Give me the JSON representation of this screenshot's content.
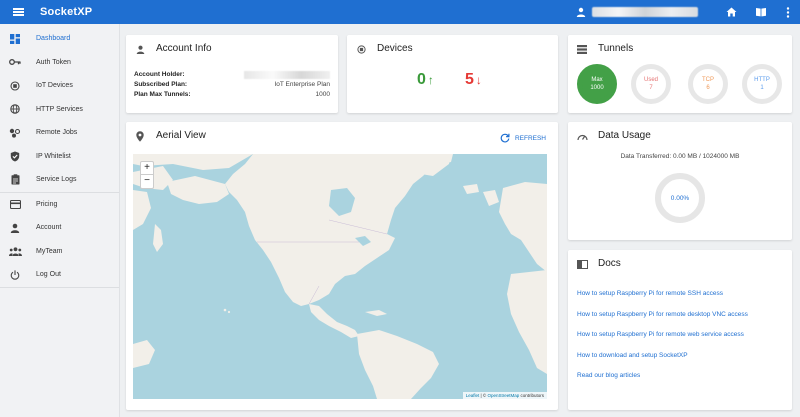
{
  "app": {
    "brand": "SocketXP"
  },
  "topbar": {
    "menu_icon": "hamburger-menu-icon",
    "user_icon": "person-icon",
    "home_icon": "home-icon",
    "docs_icon": "book-icon",
    "more_icon": "more-vertical-icon"
  },
  "sidebar": {
    "items": [
      {
        "label": "Dashboard",
        "icon": "dashboard-icon"
      },
      {
        "label": "Auth Token",
        "icon": "key-icon"
      },
      {
        "label": "IoT Devices",
        "icon": "device-icon"
      },
      {
        "label": "HTTP Services",
        "icon": "globe-icon"
      },
      {
        "label": "Remote Jobs",
        "icon": "jobs-icon"
      },
      {
        "label": "IP Whitelist",
        "icon": "shield-check-icon"
      },
      {
        "label": "Service Logs",
        "icon": "clipboard-icon"
      },
      {
        "label": "Pricing",
        "icon": "credit-card-icon"
      },
      {
        "label": "Account",
        "icon": "person-icon"
      },
      {
        "label": "MyTeam",
        "icon": "group-icon"
      },
      {
        "label": "Log Out",
        "icon": "power-icon"
      }
    ]
  },
  "account": {
    "title": "Account Info",
    "holder_label": "Account Holder:",
    "plan_label": "Subscribed Plan:",
    "plan_value": "IoT Enterprise Plan",
    "tunnels_label": "Plan Max Tunnels:",
    "tunnels_value": "1000"
  },
  "devices": {
    "title": "Devices",
    "online": "0",
    "offline": "5",
    "online_color": "#3a9a3a",
    "offline_color": "#e53935"
  },
  "tunnels": {
    "title": "Tunnels",
    "items": [
      {
        "label": "Max",
        "value": "1000",
        "color": "#43a047"
      },
      {
        "label": "Used",
        "value": "7",
        "color": "#e57373"
      },
      {
        "label": "TCP",
        "value": "6",
        "color": "#ef9a5a"
      },
      {
        "label": "HTTP",
        "value": "1",
        "color": "#5c9ded"
      }
    ]
  },
  "aerial": {
    "title": "Aerial View",
    "refresh_label": "REFRESH",
    "zoom_in": "+",
    "zoom_out": "−",
    "attribution_leaflet": "Leaflet",
    "attribution_sep": " | © ",
    "attribution_osm": "OpenStreetMap",
    "attribution_suffix": " contributors"
  },
  "data_usage": {
    "title": "Data Usage",
    "transferred": "Data Transferred: 0.00 MB / 1024000 MB",
    "percent": "0.00%"
  },
  "docs": {
    "title": "Docs",
    "links": [
      "How to setup Raspberry Pi for remote SSH access",
      "How to setup Raspberry Pi for remote desktop VNC access",
      "How to setup Raspberry Pi for remote web service access",
      "How to download and setup SocketXP",
      "Read our blog articles"
    ]
  },
  "colors": {
    "primary": "#1f6fd1",
    "sidebar_bg": "#f1f2f4",
    "page_bg": "#eef0f2"
  }
}
